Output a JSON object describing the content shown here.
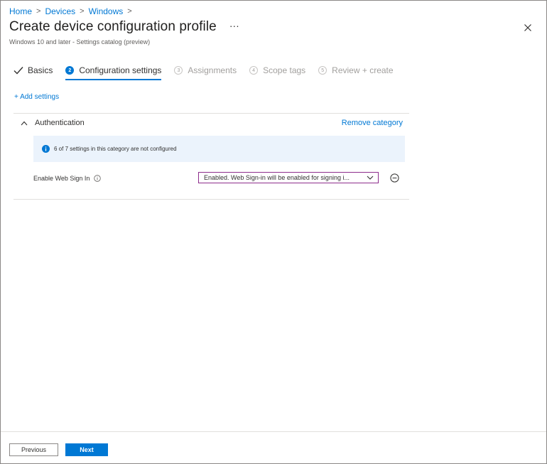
{
  "breadcrumb": {
    "items": [
      "Home",
      "Devices",
      "Windows"
    ],
    "separator": ">"
  },
  "header": {
    "title": "Create device configuration profile",
    "more_label": "···",
    "subtitle": "Windows 10 and later - Settings catalog (preview)",
    "close_icon": "close-icon"
  },
  "steps": [
    {
      "label": "Basics",
      "state": "completed",
      "icon": "checkmark-icon"
    },
    {
      "number": "2",
      "label": "Configuration settings",
      "state": "active"
    },
    {
      "number": "3",
      "label": "Assignments",
      "state": "disabled"
    },
    {
      "number": "4",
      "label": "Scope tags",
      "state": "disabled"
    },
    {
      "number": "5",
      "label": "Review + create",
      "state": "disabled"
    }
  ],
  "add_settings_label": "+ Add settings",
  "category": {
    "title": "Authentication",
    "expanded": true,
    "remove_label": "Remove category",
    "info_text": "6 of 7 settings in this category are not configured",
    "setting": {
      "label": "Enable Web Sign In",
      "value": "Enabled. Web Sign-in will be enabled for signing i...",
      "remove_icon": "remove-circle-icon"
    }
  },
  "footer": {
    "previous_label": "Previous",
    "next_label": "Next"
  },
  "colors": {
    "accent": "#0078d4",
    "dropdown_border": "#8d2c8c",
    "info_bg": "#ebf3fc"
  }
}
